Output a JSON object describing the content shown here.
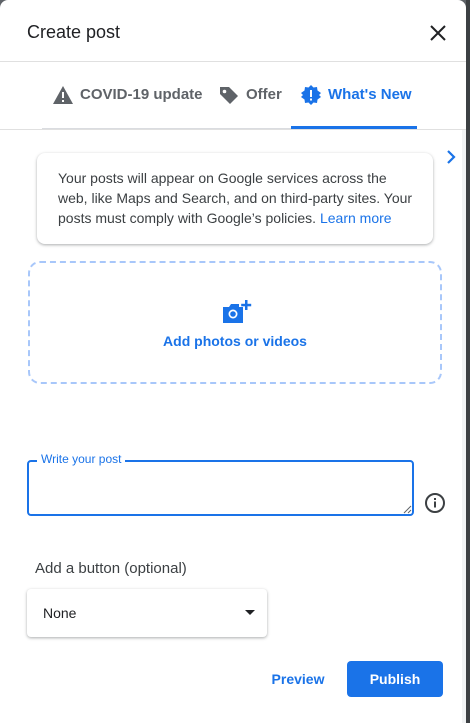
{
  "dialog": {
    "title": "Create post",
    "close_icon": "close-icon"
  },
  "tabs": [
    {
      "label": "COVID-19 update",
      "icon": "warning-icon",
      "active": false
    },
    {
      "label": "Offer",
      "icon": "tag-icon",
      "active": false
    },
    {
      "label": "What's New",
      "icon": "new-badge-icon",
      "active": true
    }
  ],
  "notice": {
    "text": "Your posts will appear on Google services across the web, like Maps and Search, and on third-party sites. Your posts must comply with Google’s policies.",
    "link": "Learn more"
  },
  "upload": {
    "label": "Add photos or videos",
    "icon": "add-photo-icon"
  },
  "post_field": {
    "label": "Write your post",
    "value": ""
  },
  "add_button": {
    "label": "Add a button (optional)",
    "selected": "None"
  },
  "actions": {
    "preview": "Preview",
    "publish": "Publish"
  },
  "colors": {
    "accent": "#1a73e8",
    "text": "#202124",
    "muted": "#5f6368"
  }
}
